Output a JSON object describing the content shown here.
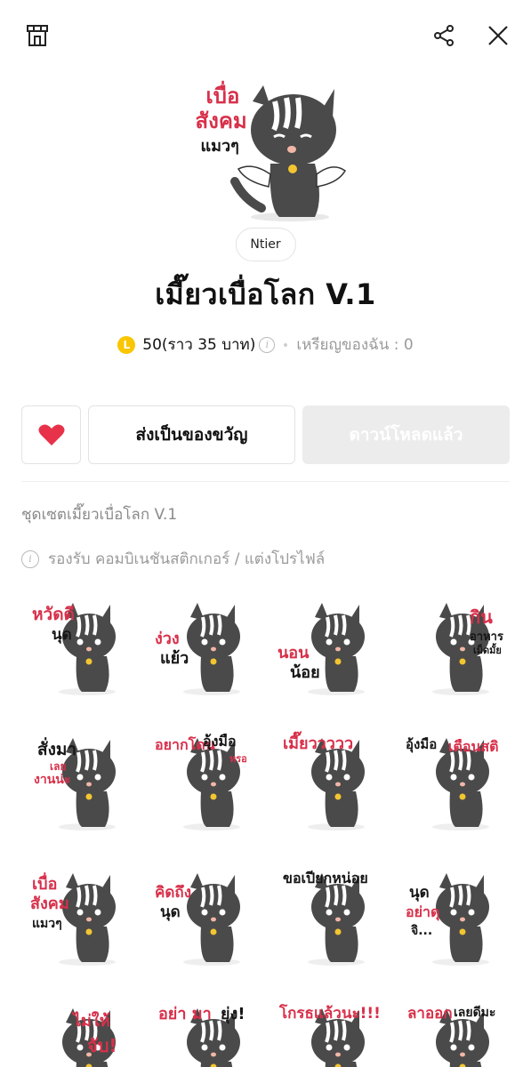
{
  "header": {
    "store_icon": "store-icon",
    "share_icon": "share-icon",
    "close_icon": "close-icon"
  },
  "hero": {
    "text_line1": "เบื่อ",
    "text_line2": "สังคม",
    "text_line3": "แมวๆ"
  },
  "author": "Ntier",
  "title": "เมี๊ยวเบื่อโลก V.1",
  "price": {
    "coin_symbol": "L",
    "amount": "50(ราว 35 บาท)",
    "my_coins": "เหรียญของฉัน : 0"
  },
  "actions": {
    "favorite_icon": "heart-icon",
    "gift_label": "ส่งเป็นของขวัญ",
    "download_label": "ดาวน์โหลดแล้ว"
  },
  "description": "ชุดเซตเมี๊ยวเบื่อโลก V.1",
  "support_text": "รองรับ คอมบิเนชันสติกเกอร์ / แต่งโปรไฟล์",
  "colors": {
    "accent_red": "#d8304a",
    "coin_yellow": "#f9c600",
    "favorite_red": "#e8324a",
    "cat_gray": "#4a4a4a"
  },
  "stickers": [
    {
      "line1": "หวัดดี",
      "line2": "นุด"
    },
    {
      "line1": "ง่วง",
      "line2": "แย้ว"
    },
    {
      "line1": "นอน",
      "line2": "น้อย"
    },
    {
      "line1": "กิน",
      "line2": "อาหาร",
      "line3": "เม็ดมั้ย"
    },
    {
      "line1": "สั่งมา",
      "line2": "เลย",
      "line3": "งานน่ะ"
    },
    {
      "line1": "อยากโดน",
      "line2": "อุ้งมือ",
      "line3": "หรอ"
    },
    {
      "line1": "เมี๊ยววววว"
    },
    {
      "line1": "อุ้งมือ",
      "line2": "เตือนสติ"
    },
    {
      "line1": "เบื่อ",
      "line2": "สังคม",
      "line3": "แมวๆ"
    },
    {
      "line1": "คิดถึง",
      "line2": "นุด"
    },
    {
      "line1": "ขอเปียกหน่อย"
    },
    {
      "line1": "นุด",
      "line2": "อย่าดุ",
      "line3": "จิ..."
    },
    {
      "line1": "ไม่ให้",
      "line2": "จับ!"
    },
    {
      "line1": "อย่า มา",
      "line2": "ยุ่ง!"
    },
    {
      "line1": "โกรธแล้วนะ!!!"
    },
    {
      "line1": "ลาออก",
      "line2": "เลยดีมะ"
    }
  ]
}
